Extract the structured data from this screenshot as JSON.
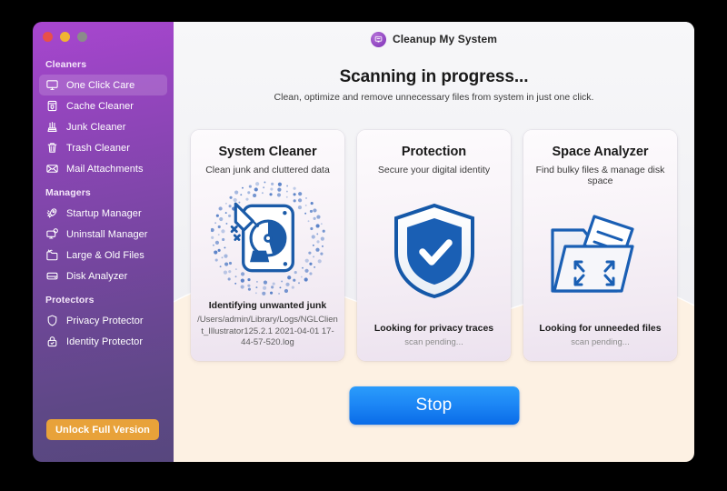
{
  "window": {
    "traffic_lights": [
      "close",
      "minimize",
      "zoom"
    ],
    "app_title": "Cleanup My System",
    "app_logo_icon": "monitor-circle-icon"
  },
  "sidebar": {
    "groups": [
      {
        "title": "Cleaners",
        "items": [
          {
            "label": "One Click Care",
            "icon": "monitor-icon",
            "selected": true
          },
          {
            "label": "Cache Cleaner",
            "icon": "cache-box-icon",
            "selected": false
          },
          {
            "label": "Junk Cleaner",
            "icon": "broom-icon",
            "selected": false
          },
          {
            "label": "Trash Cleaner",
            "icon": "trash-icon",
            "selected": false
          },
          {
            "label": "Mail Attachments",
            "icon": "envelope-icon",
            "selected": false
          }
        ]
      },
      {
        "title": "Managers",
        "items": [
          {
            "label": "Startup Manager",
            "icon": "rocket-icon",
            "selected": false
          },
          {
            "label": "Uninstall Manager",
            "icon": "monitor-gear-icon",
            "selected": false
          },
          {
            "label": "Large & Old Files",
            "icon": "folder-clock-icon",
            "selected": false
          },
          {
            "label": "Disk Analyzer",
            "icon": "harddrive-icon",
            "selected": false
          }
        ]
      },
      {
        "title": "Protectors",
        "items": [
          {
            "label": "Privacy Protector",
            "icon": "shield-icon",
            "selected": false
          },
          {
            "label": "Identity Protector",
            "icon": "lock-icon",
            "selected": false
          }
        ]
      }
    ],
    "unlock_label": "Unlock Full Version"
  },
  "main": {
    "headline": "Scanning in progress...",
    "subheadline": "Clean, optimize and remove unnecessary files from system in just one click.",
    "stop_label": "Stop",
    "cards": [
      {
        "title": "System Cleaner",
        "subtitle": "Clean junk and cluttered data",
        "art_icon": "harddrive-broom-icon",
        "status": "Identifying unwanted junk",
        "detail": "/Users/admin/Library/Logs/NGLClient_Illustrator125.2.1 2021-04-01 17-44-57-520.log",
        "detail_pending": false
      },
      {
        "title": "Protection",
        "subtitle": "Secure your digital identity",
        "art_icon": "shield-check-icon",
        "status": "Looking for privacy traces",
        "detail": "scan pending...",
        "detail_pending": true
      },
      {
        "title": "Space Analyzer",
        "subtitle": "Find bulky files & manage disk space",
        "art_icon": "folder-expand-icon",
        "status": "Looking for unneeded files",
        "detail": "scan pending...",
        "detail_pending": true
      }
    ]
  },
  "colors": {
    "sidebar_top": "#a846cf",
    "sidebar_bottom": "#57477e",
    "accent_orange": "#e8a23a",
    "accent_blue": "#1c86f5",
    "icon_blue": "#1b5ba8",
    "cream": "#fdf1e3"
  }
}
